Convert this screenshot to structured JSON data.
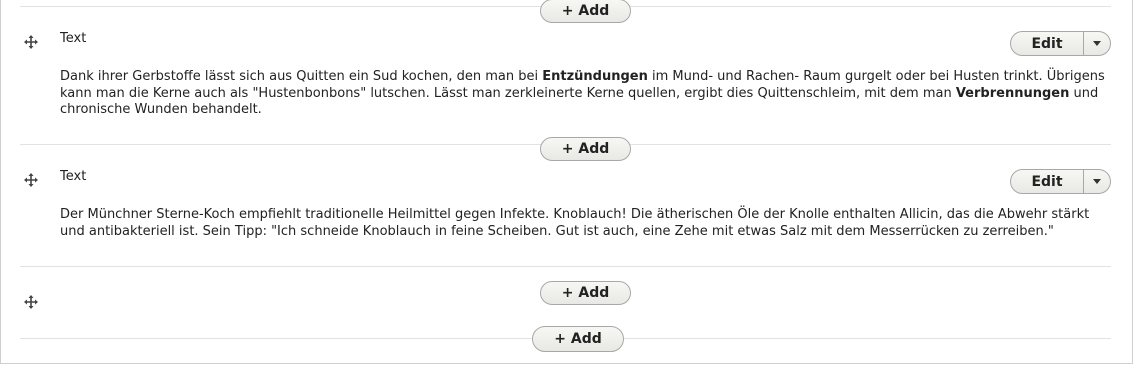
{
  "add_label": "+ Add",
  "paragraphs": [
    {
      "type_label": "Text",
      "edit_label": "Edit",
      "text": {
        "p1": "Dank ihrer Gerbstoffe lässt sich aus Quitten ein Sud kochen, den man bei ",
        "b1": "Entzündungen",
        "p2": " im Mund- und Rachen- Raum gurgelt oder bei Husten trinkt. Übrigens kann man die Kerne auch als \"Hustenbonbons\" lutschen. Lässt man zerkleinerte Kerne quellen, ergibt dies Quittenschleim, mit dem man ",
        "b2": "Verbrennungen",
        "p3": " und chronische Wunden behandelt."
      }
    },
    {
      "type_label": "Text",
      "edit_label": "Edit",
      "text": {
        "p1": "Der Münchner Sterne-Koch empfiehlt traditionelle Heilmittel gegen Infekte. Knoblauch! Die ätherischen Öle der Knolle enthalten Allicin, das die Abwehr stärkt und antibakteriell ist. Sein Tipp: \"Ich schneide Knoblauch in feine Scheiben. Gut ist auch, eine Zehe mit etwas Salz mit dem Messerrücken zu zerreiben.\""
      }
    }
  ],
  "icons": {
    "drag": "move-arrows-icon",
    "dropdown": "caret-down-icon"
  }
}
